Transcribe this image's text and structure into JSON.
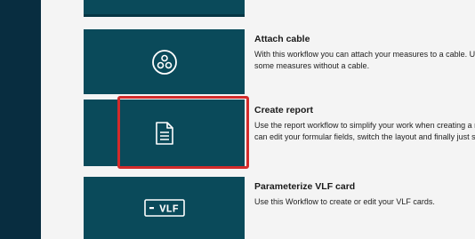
{
  "workflows": [
    {
      "icon": "cable-nodes-icon",
      "title": "Attach cable",
      "description_lines": [
        "With this workflow you can attach your measures to a cable. Use this if you h",
        "some measures without a cable."
      ]
    },
    {
      "icon": "document-icon",
      "title": "Create report",
      "selected": true,
      "description_lines": [
        "Use the report workflow to simplify your work when creating a report from y",
        "can edit your formular fields, switch the layout and finally just store or print"
      ]
    },
    {
      "icon": "vlf-card-icon",
      "icon_text": "VLF",
      "title": "Parameterize VLF card",
      "description_lines": [
        "Use this Workflow to create or edit your VLF cards."
      ]
    }
  ],
  "colors": {
    "rail": "#082d40",
    "tile": "#0a4a5a",
    "highlight": "#d32b2b",
    "background": "#f4f4f4"
  }
}
